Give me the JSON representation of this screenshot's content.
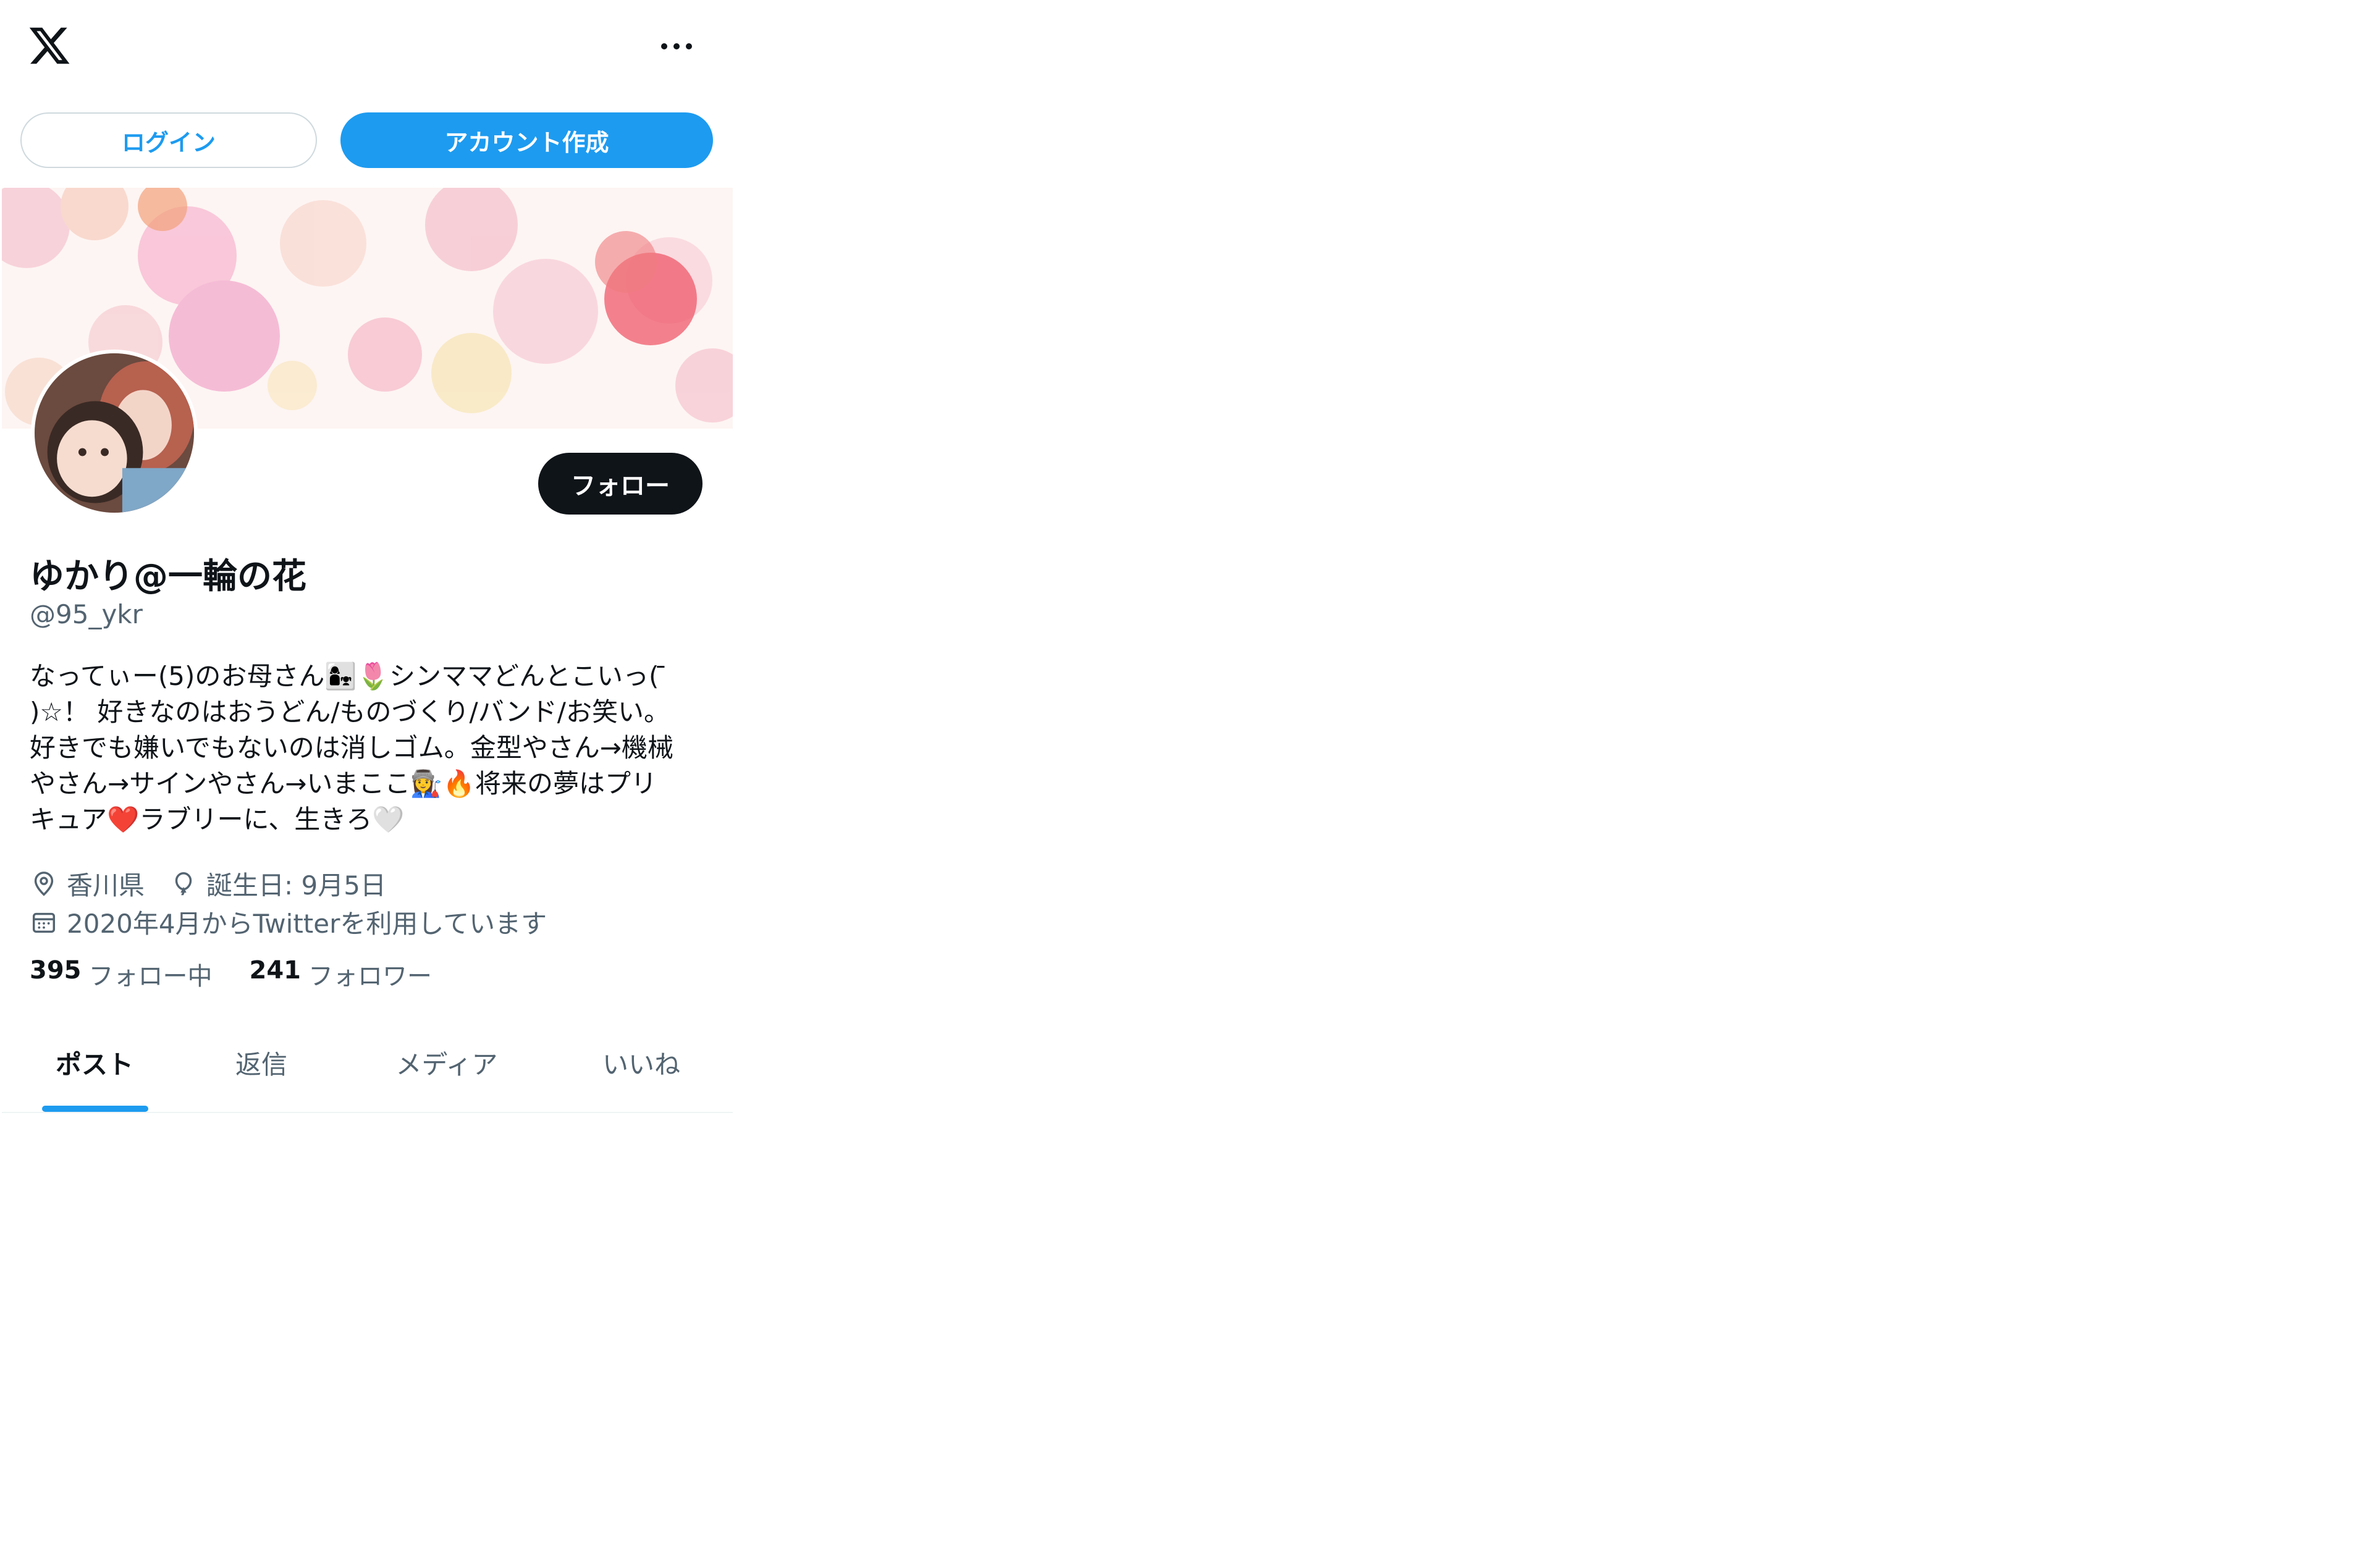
{
  "header": {
    "logo_icon": "x-logo-icon",
    "more_icon": "more-horizontal-icon"
  },
  "auth": {
    "login_label": "ログイン",
    "signup_label": "アカウント作成"
  },
  "profile": {
    "follow_label": "フォロー",
    "display_name": "ゆかり@一輪の花",
    "handle": "@95_ykr",
    "bio_lines": [
      "なってぃー(5)のお母さん👩‍👧🌷シンママどんとこいっ( ̄",
      ")☆！ 好きなのはおうどん/ものづくり/バンド/お笑い。",
      "好きでも嫌いでもないのは消しゴム。金型やさん→機械",
      "やさん→サインやさん→いまここ👩‍🏭🔥将来の夢はプリ",
      "キュア❤️ラブリーに、生きろ🤍"
    ],
    "location": "香川県",
    "birthday": "誕生日: 9月5日",
    "joined": "2020年4月からTwitterを利用しています",
    "following_count": "395",
    "following_label": "フォロー中",
    "followers_count": "241",
    "followers_label": "フォロワー"
  },
  "tabs": [
    {
      "label": "ポスト",
      "active": true
    },
    {
      "label": "返信",
      "active": false
    },
    {
      "label": "メディア",
      "active": false
    },
    {
      "label": "いいね",
      "active": false
    }
  ],
  "colors": {
    "accent": "#1d9bf0",
    "text": "#0f1419",
    "secondary": "#536471"
  }
}
